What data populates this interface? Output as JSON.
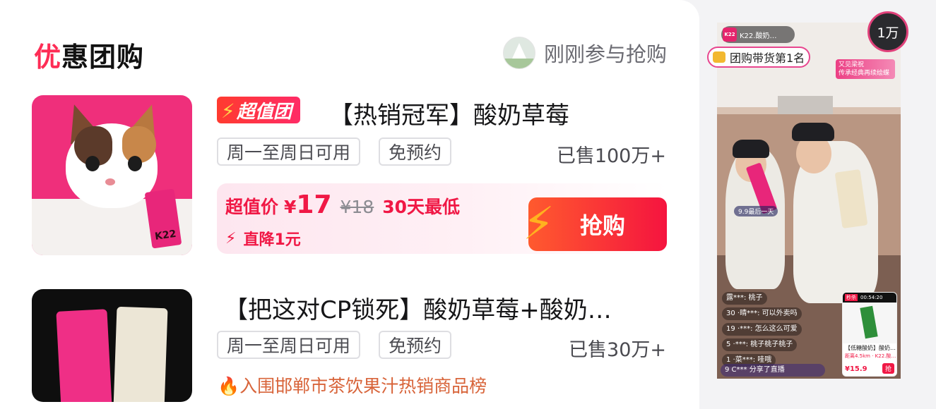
{
  "section": {
    "title_first": "优",
    "title_rest": "惠团购"
  },
  "recent": {
    "text": "刚刚参与抢购"
  },
  "products": [
    {
      "badge": "超值团",
      "title": "【热销冠军】酸奶草莓",
      "tags": [
        "周一至周日可用",
        "免预约"
      ],
      "sold": "已售100万+",
      "price_label": "超值价",
      "currency": "¥",
      "price": "17",
      "original_price": "¥18",
      "lowest_label": "30天最低",
      "drop": "直降1元",
      "buy": "抢购",
      "can_label": "K22"
    },
    {
      "title": "【把这对CP锁死】酸奶草莓+酸奶…",
      "tags": [
        "周一至周日可用",
        "免预约"
      ],
      "sold": "已售30万+",
      "rank": "入围邯郸市茶饮果汁热销商品榜"
    }
  ],
  "live": {
    "viewers": "1万",
    "rank_chip": "团购带货第1名",
    "host_name": "K22.酸奶…",
    "host_logo": "K22",
    "promo_title": "又见梁祝",
    "promo_sub": "传承经典再续绘蝶",
    "sticker_1": "9.9最后一天",
    "comments": [
      "露***: 桃子",
      "30 ·晴***: 可以外卖吗",
      "19 ·***: 怎么这么可爱",
      "5 ·***: 桃子桃子桃子",
      "1 ·菜***: 哇哦",
      "9 C***  分享了直播"
    ],
    "mini_card": {
      "flash": "秒杀",
      "timer": "00:54:20",
      "title": "【低糖酸奶】酸奶…",
      "distance": "距离4.5km · K22.酸…",
      "price": "¥15.9",
      "buy": "抢"
    }
  },
  "colors": {
    "accent": "#fe2c55",
    "price_red": "#f01845",
    "rank_border": "#e8468f"
  }
}
